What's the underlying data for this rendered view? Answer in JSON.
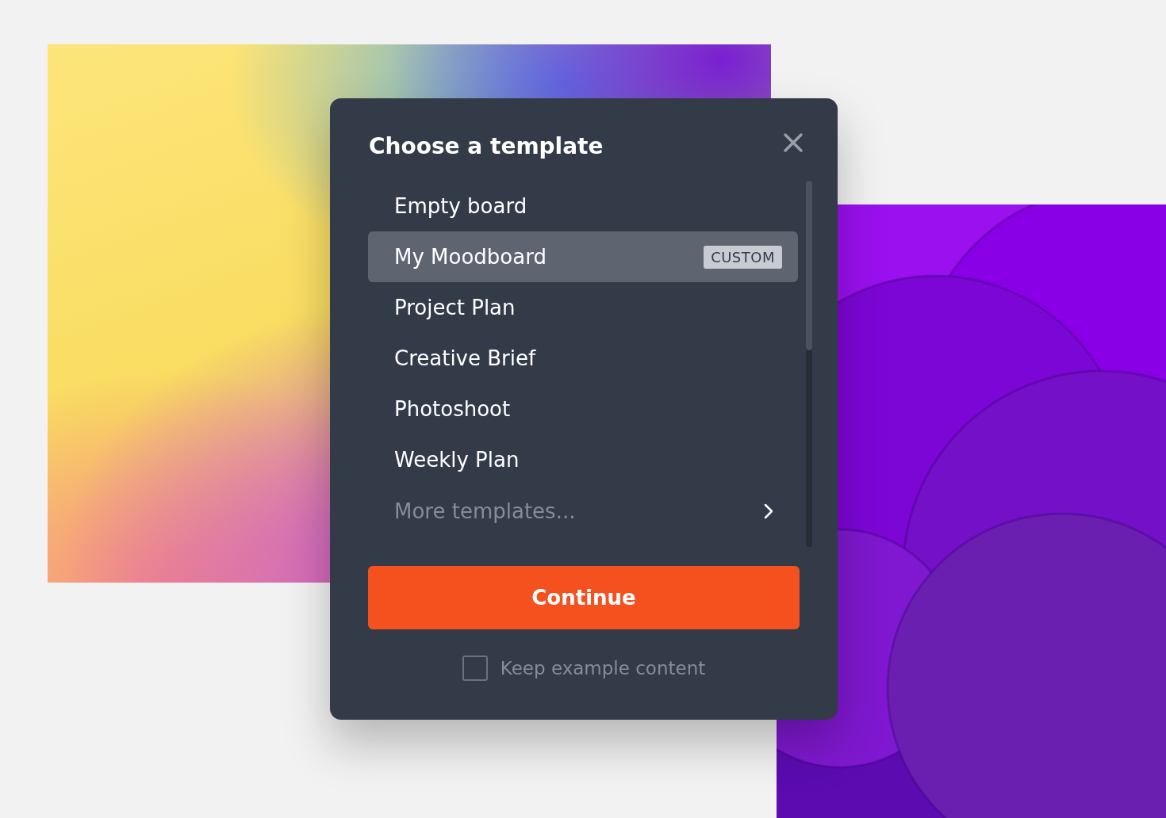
{
  "dialog": {
    "title": "Choose a template",
    "items": [
      {
        "label": "Empty board",
        "selected": false
      },
      {
        "label": "My Moodboard",
        "selected": true,
        "badge": "CUSTOM"
      },
      {
        "label": "Project Plan",
        "selected": false
      },
      {
        "label": "Creative Brief",
        "selected": false
      },
      {
        "label": "Photoshoot",
        "selected": false
      },
      {
        "label": "Weekly Plan",
        "selected": false
      }
    ],
    "more_link": "More templates...",
    "continue_button": "Continue",
    "checkbox": {
      "label": "Keep example content",
      "checked": false
    }
  }
}
